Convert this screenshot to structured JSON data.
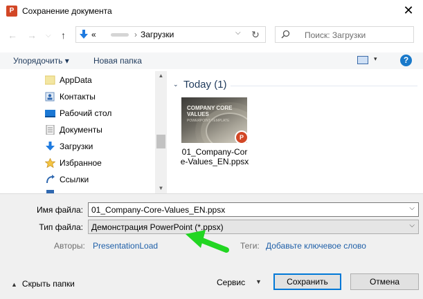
{
  "window": {
    "title": "Сохранение документа",
    "app_icon": "powerpoint-icon",
    "close_symbol": "✕"
  },
  "navigation": {
    "back_symbol": "←",
    "forward_symbol": "→",
    "recent_symbol": "⌵",
    "up_symbol": "↑",
    "address_prefix": "«",
    "address_folder": "Загрузки",
    "address_chevron": "⌵",
    "refresh_symbol": "↻",
    "search_placeholder": "Поиск: Загрузки"
  },
  "toolbar": {
    "organize_label": "Упорядочить ▾",
    "new_folder_label": "Новая папка",
    "view_chevron": "▾",
    "help_label": "?"
  },
  "tree": {
    "items": [
      {
        "label": "AppData",
        "icon": "folder-icon"
      },
      {
        "label": "Контакты",
        "icon": "contacts-icon"
      },
      {
        "label": "Рабочий стол",
        "icon": "desktop-icon"
      },
      {
        "label": "Документы",
        "icon": "documents-icon"
      },
      {
        "label": "Загрузки",
        "icon": "downloads-icon"
      },
      {
        "label": "Избранное",
        "icon": "favorites-star-icon"
      },
      {
        "label": "Ссылки",
        "icon": "links-icon"
      }
    ],
    "scroll_up": "▲",
    "scroll_down": "▼"
  },
  "files": {
    "group_chevron": "⌄",
    "group_title": "Today (1)",
    "items": [
      {
        "name": "01_Company-Core-Values_EN.ppsx",
        "thumb_title": "COMPANY CORE VALUES",
        "thumb_subtitle": "POWERPOINT TEMPLATE",
        "badge": "P"
      }
    ]
  },
  "form": {
    "filename_label": "Имя файла:",
    "filename_value": "01_Company-Core-Values_EN.ppsx",
    "filetype_label": "Тип файла:",
    "filetype_value": "Демонстрация PowerPoint (*.ppsx)",
    "field_chevron": "⌵",
    "authors_label": "Авторы:",
    "authors_value": "PresentationLoad",
    "tags_label": "Теги:",
    "tags_value": "Добавьте ключевое слово"
  },
  "footer": {
    "hide_folders_chevron": "▲",
    "hide_folders_label": "Скрыть папки",
    "service_label": "Сервис",
    "service_chevron": "▼",
    "save_label": "Сохранить",
    "cancel_label": "Отмена"
  },
  "colors": {
    "annotation_arrow": "#22d622",
    "accent": "#0078d7",
    "link": "#1e5fa8"
  }
}
